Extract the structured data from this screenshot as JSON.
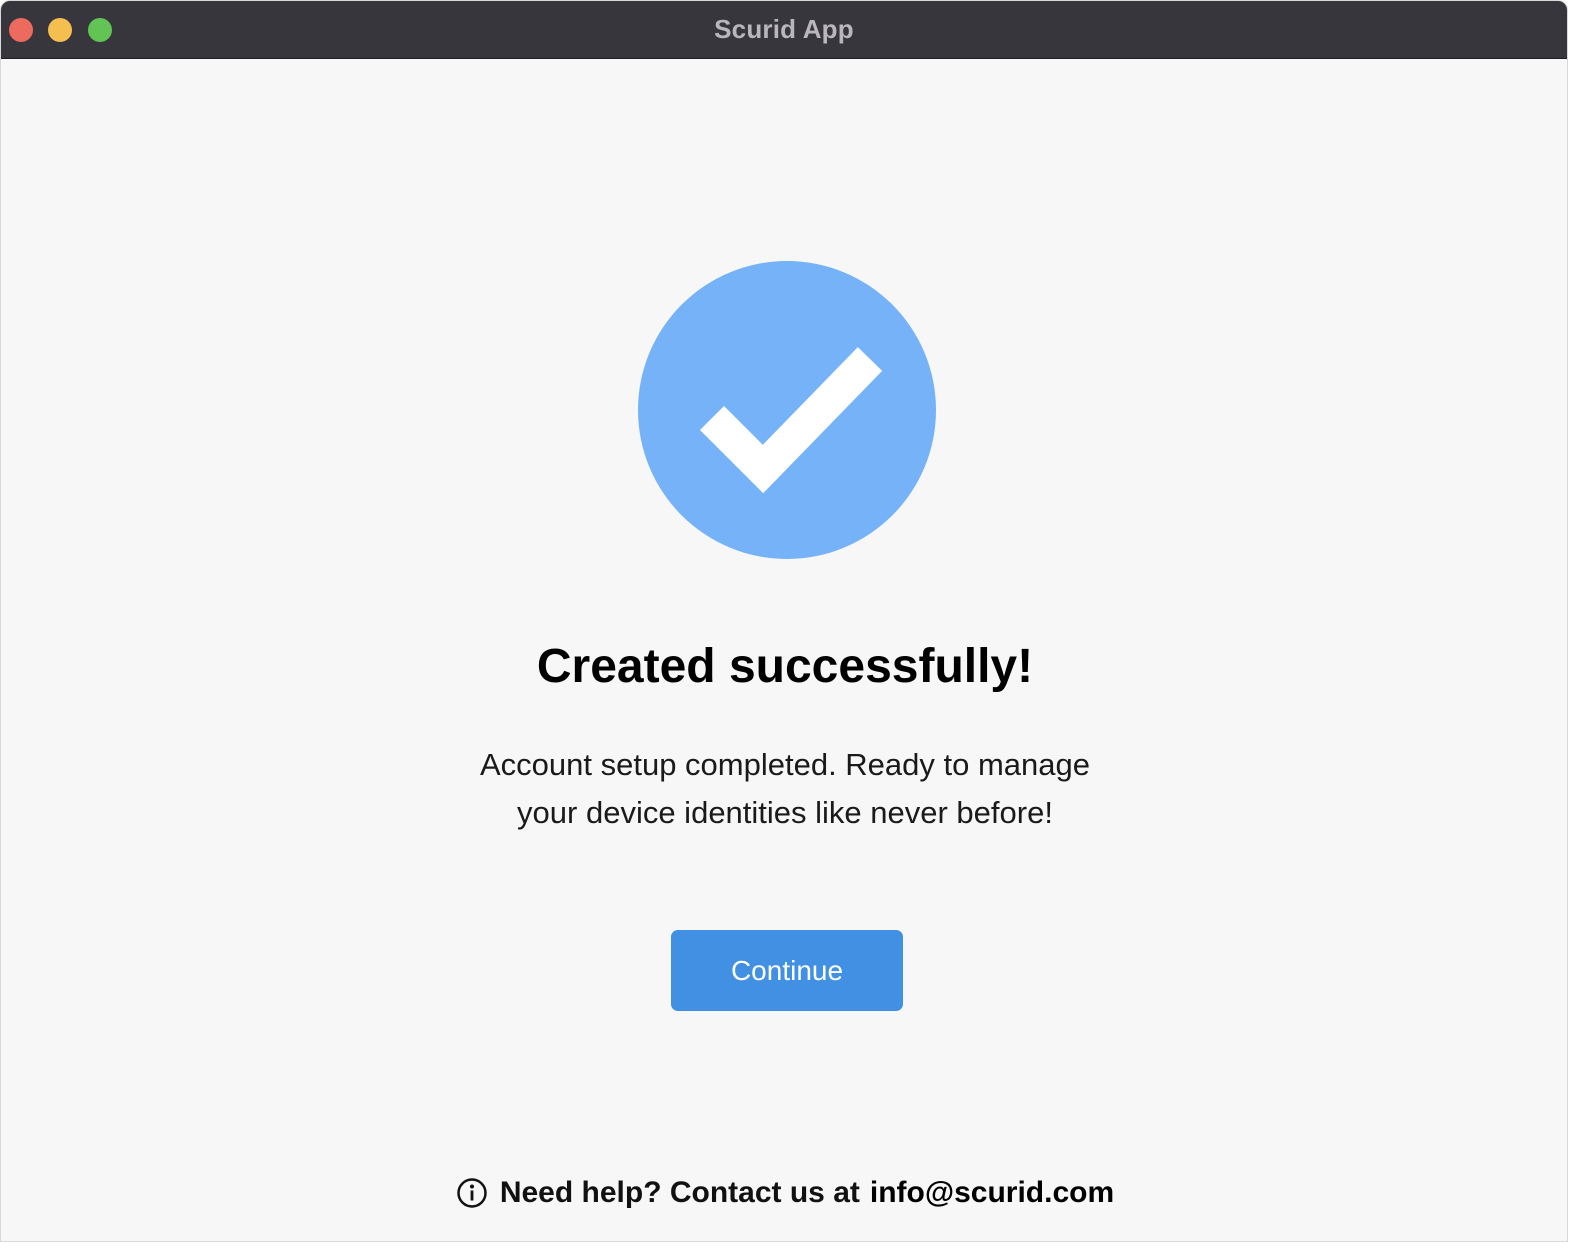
{
  "window": {
    "title": "Scurid App"
  },
  "success": {
    "icon": "check-circle-icon",
    "circle_color": "#75b2f8",
    "headline": "Created successfully!",
    "message_line1": "Account setup completed. Ready to manage",
    "message_line2": "your device identities like never before!"
  },
  "actions": {
    "continue_label": "Continue",
    "button_color": "#4290e3"
  },
  "help": {
    "icon": "info-icon",
    "text": "Need help? Contact us at",
    "email": "info@scurid.com"
  }
}
